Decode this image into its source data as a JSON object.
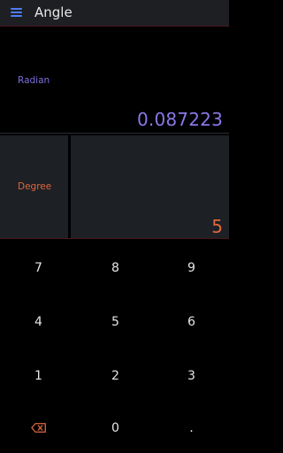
{
  "appbar": {
    "title": "Angle",
    "menu_icon": "menu-icon"
  },
  "radian": {
    "label": "Radian",
    "value": "0.087223"
  },
  "degree": {
    "label": "Degree",
    "value": "5"
  },
  "keypad": {
    "keys": [
      "7",
      "8",
      "9",
      "4",
      "5",
      "6",
      "1",
      "2",
      "3",
      "",
      "0",
      "."
    ],
    "backspace_icon": "backspace-icon"
  },
  "colors": {
    "radian_accent": "#8a78e6",
    "degree_accent": "#e0673e",
    "menu_icon": "#4f7dff",
    "panel_bg": "#1d2024"
  }
}
